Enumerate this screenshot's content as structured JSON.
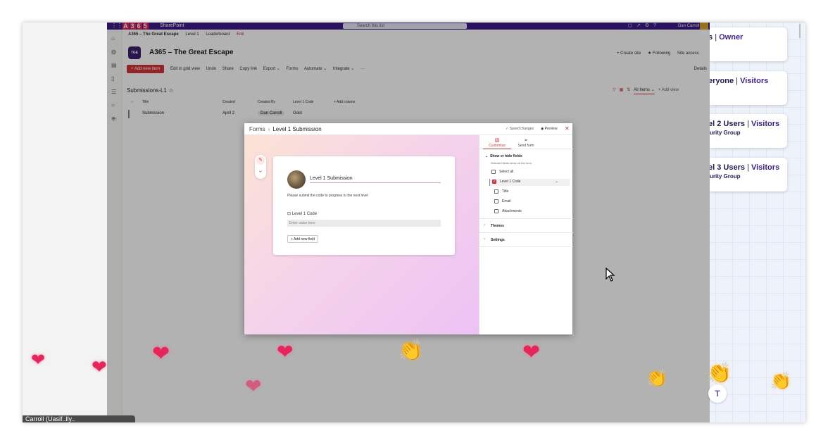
{
  "suitebar": {
    "waffle_icon": "waffle-icon",
    "logo_letters": [
      "A",
      "3",
      "6",
      "5"
    ],
    "app_name": "SharePoint",
    "search_placeholder": "Search this list",
    "user_name": "Dan Carroll"
  },
  "site": {
    "nav": {
      "site": "A365 – The Great Escape",
      "item1": "Level 1",
      "item2": "Leaderboard",
      "edit": "Edit"
    },
    "logo_text": "TGE",
    "title": "A365 – The Great Escape",
    "actions": {
      "create_site": "+ Create site",
      "following": "★ Following",
      "site_access": "Site access"
    }
  },
  "commands": {
    "new_item": "+ Add new item",
    "items": [
      "Edit in grid view",
      "Undo",
      "Share",
      "Copy link",
      "Export ⌄",
      "Forms",
      "Automate ⌄",
      "Integrate ⌄",
      "···"
    ],
    "details": "Details"
  },
  "list": {
    "title": "Submissions-L1",
    "all_items": "All Items ⌄",
    "add_view": "+ Add view",
    "headers": {
      "title": "Title",
      "created": "Created",
      "created_by": "Created By",
      "level_code": "Level 1 Code",
      "add_column": "+ Add column"
    },
    "row": {
      "title": "Submission",
      "created": "April 2",
      "created_by": "Dan Carroll",
      "level_code": "Gold"
    }
  },
  "role_cards": [
    {
      "line1_a": "s",
      "line1_role": "Owner",
      "line2": ""
    },
    {
      "line1_a": "eryone",
      "line1_role": "Visitors",
      "line2": ""
    },
    {
      "line1_a": "el 2 Users",
      "line1_role": "Visitors",
      "line2": "urity Group"
    },
    {
      "line1_a": "el 3 Users",
      "line1_role": "Visitors",
      "line2": "urity Group"
    }
  ],
  "caption": "Carroll (Uasif..lly..",
  "dialog": {
    "breadcrumb_root": "Forms",
    "breadcrumb_current": "Level 1 Submission",
    "saved": "✓ Saved changes",
    "preview": "Preview",
    "form": {
      "title": "Level 1 Submission",
      "description": "Please submit the code to progress to the next level",
      "field_label": "Level 1 Code",
      "field_placeholder": "Enter value here",
      "add_field": "+ Add new field"
    },
    "panel": {
      "tab_customize": "Customize",
      "tab_send": "Send form",
      "fields_title": "Show or hide fields",
      "fields_sub": "Selected fields show on the form",
      "select_all": "Select all",
      "level1_code": "Level 1 Code",
      "sub_fields": [
        "Title",
        "Email",
        "Attachments"
      ],
      "themes": "Themes",
      "settings": "Settings"
    }
  },
  "colors": {
    "suite_purple": "#3d1a87",
    "accent_red": "#d13438",
    "heart": "#e8245a"
  }
}
